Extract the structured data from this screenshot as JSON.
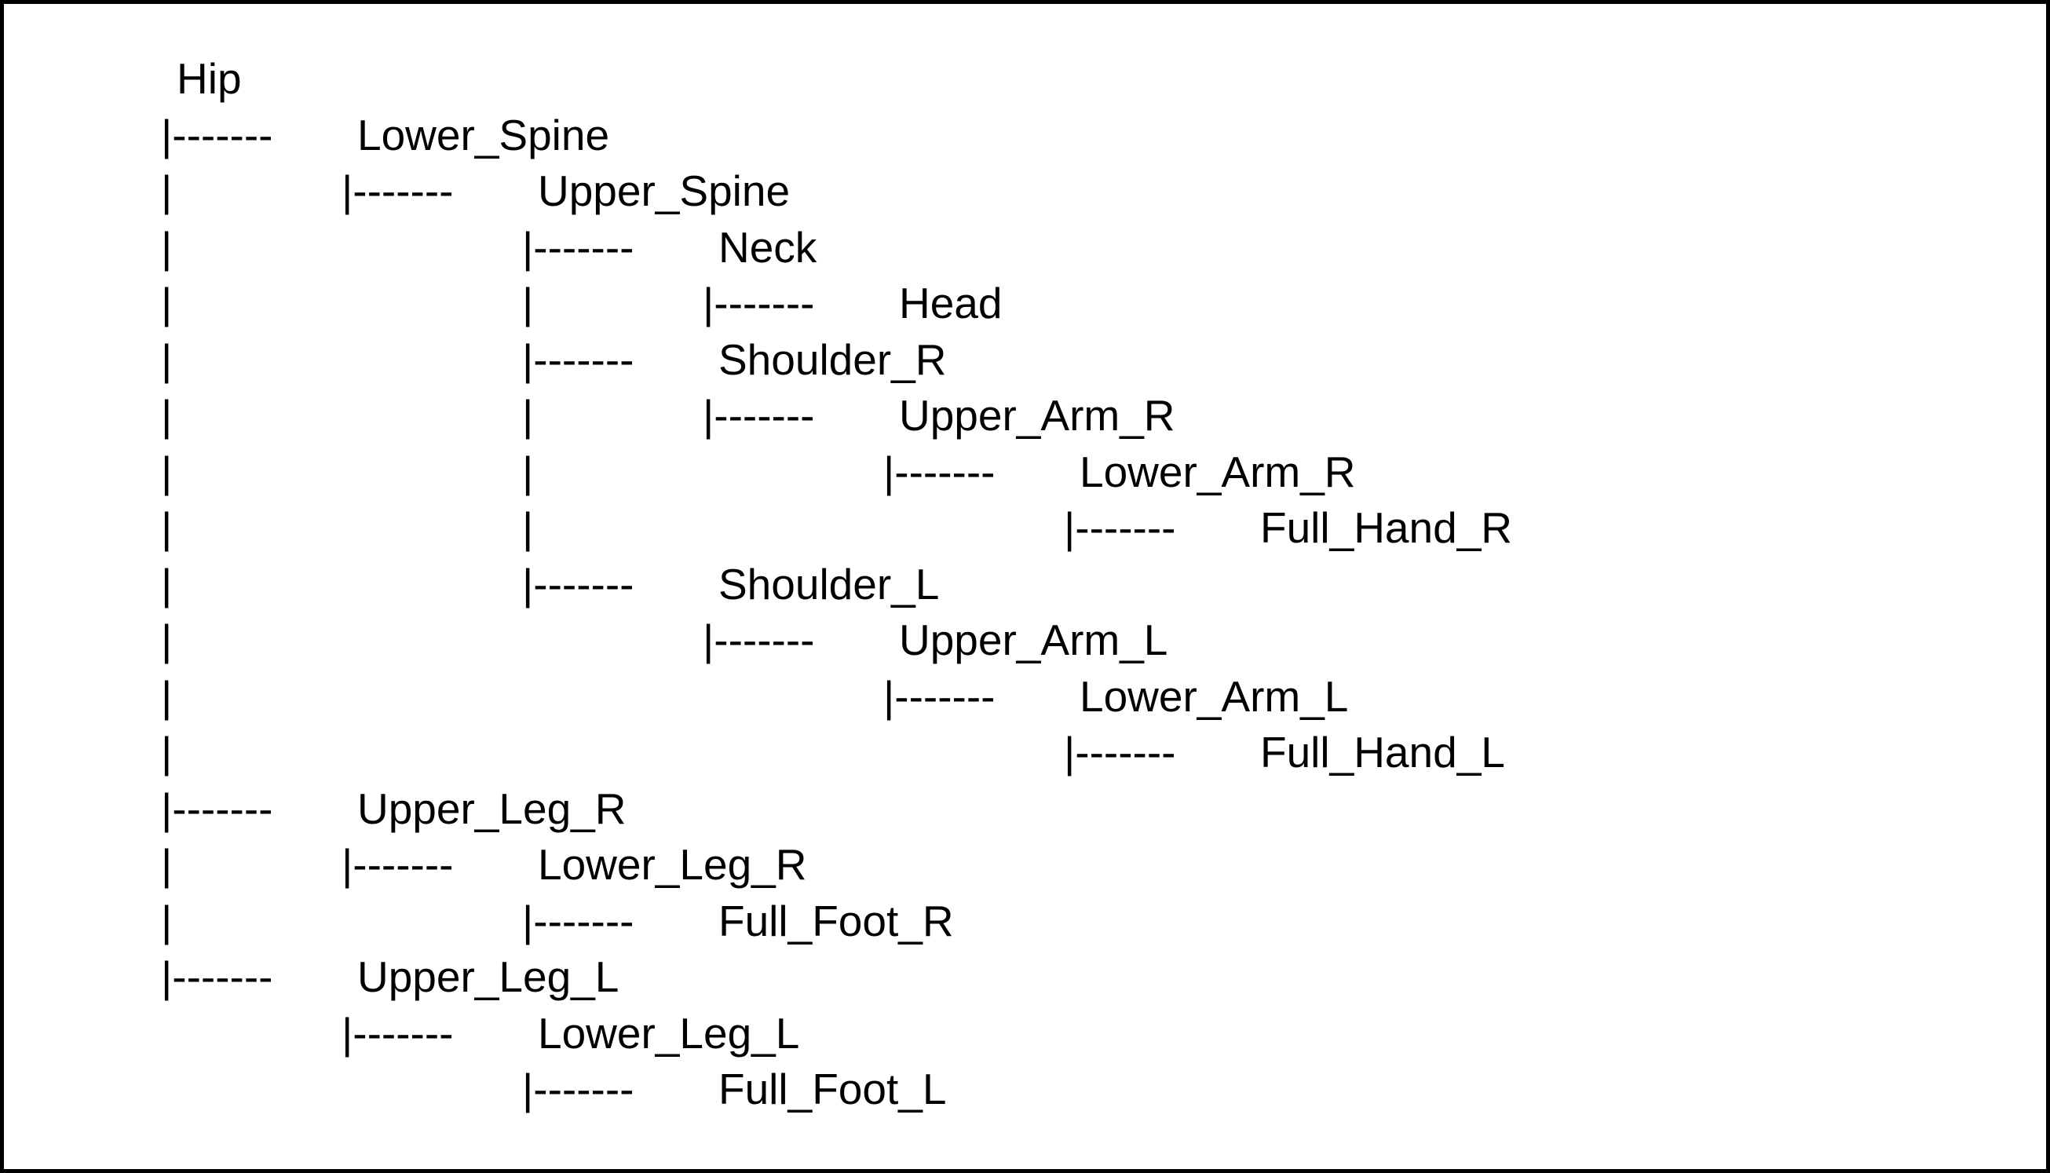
{
  "hierarchy": {
    "name": "Hip",
    "children": [
      {
        "name": "Lower_Spine",
        "children": [
          {
            "name": "Upper_Spine",
            "children": [
              {
                "name": "Neck",
                "children": [
                  {
                    "name": "Head",
                    "children": []
                  }
                ]
              },
              {
                "name": "Shoulder_R",
                "children": [
                  {
                    "name": "Upper_Arm_R",
                    "children": [
                      {
                        "name": "Lower_Arm_R",
                        "children": [
                          {
                            "name": "Full_Hand_R",
                            "children": []
                          }
                        ]
                      }
                    ]
                  }
                ]
              },
              {
                "name": "Shoulder_L",
                "children": [
                  {
                    "name": "Upper_Arm_L",
                    "children": [
                      {
                        "name": "Lower_Arm_L",
                        "children": [
                          {
                            "name": "Full_Hand_L",
                            "children": []
                          }
                        ]
                      }
                    ]
                  }
                ]
              }
            ]
          }
        ]
      },
      {
        "name": "Upper_Leg_R",
        "children": [
          {
            "name": "Lower_Leg_R",
            "children": [
              {
                "name": "Full_Foot_R",
                "children": []
              }
            ]
          }
        ]
      },
      {
        "name": "Upper_Leg_L",
        "children": [
          {
            "name": "Lower_Leg_L",
            "children": [
              {
                "name": "Full_Foot_L",
                "children": []
              }
            ]
          }
        ]
      }
    ]
  },
  "rows": [
    {
      "cols": [],
      "label_path": "hierarchy.name"
    },
    {
      "cols": [
        "branch"
      ],
      "label_path": "hierarchy.children.0.name"
    },
    {
      "cols": [
        "pipe",
        "branch"
      ],
      "label_path": "hierarchy.children.0.children.0.name"
    },
    {
      "cols": [
        "pipe",
        "",
        "branch"
      ],
      "label_path": "hierarchy.children.0.children.0.children.0.name"
    },
    {
      "cols": [
        "pipe",
        "",
        "pipe",
        "branch"
      ],
      "label_path": "hierarchy.children.0.children.0.children.0.children.0.name"
    },
    {
      "cols": [
        "pipe",
        "",
        "branch"
      ],
      "label_path": "hierarchy.children.0.children.0.children.1.name"
    },
    {
      "cols": [
        "pipe",
        "",
        "pipe",
        "branch"
      ],
      "label_path": "hierarchy.children.0.children.0.children.1.children.0.name"
    },
    {
      "cols": [
        "pipe",
        "",
        "pipe",
        "",
        "branch"
      ],
      "label_path": "hierarchy.children.0.children.0.children.1.children.0.children.0.name"
    },
    {
      "cols": [
        "pipe",
        "",
        "pipe",
        "",
        "",
        "branch"
      ],
      "label_path": "hierarchy.children.0.children.0.children.1.children.0.children.0.children.0.name"
    },
    {
      "cols": [
        "pipe",
        "",
        "branch"
      ],
      "label_path": "hierarchy.children.0.children.0.children.2.name"
    },
    {
      "cols": [
        "pipe",
        "",
        "",
        "branch"
      ],
      "label_path": "hierarchy.children.0.children.0.children.2.children.0.name"
    },
    {
      "cols": [
        "pipe",
        "",
        "",
        "",
        "branch"
      ],
      "label_path": "hierarchy.children.0.children.0.children.2.children.0.children.0.name"
    },
    {
      "cols": [
        "pipe",
        "",
        "",
        "",
        "",
        "branch"
      ],
      "label_path": "hierarchy.children.0.children.0.children.2.children.0.children.0.children.0.name"
    },
    {
      "cols": [
        "branch"
      ],
      "label_path": "hierarchy.children.1.name"
    },
    {
      "cols": [
        "pipe",
        "branch"
      ],
      "label_path": "hierarchy.children.1.children.0.name"
    },
    {
      "cols": [
        "pipe",
        "",
        "branch"
      ],
      "label_path": "hierarchy.children.1.children.0.children.0.name"
    },
    {
      "cols": [
        "branch"
      ],
      "label_path": "hierarchy.children.2.name"
    },
    {
      "cols": [
        "",
        "branch"
      ],
      "label_path": "hierarchy.children.2.children.0.name"
    },
    {
      "cols": [
        "",
        "",
        "branch"
      ],
      "label_path": "hierarchy.children.2.children.0.children.0.name"
    }
  ]
}
